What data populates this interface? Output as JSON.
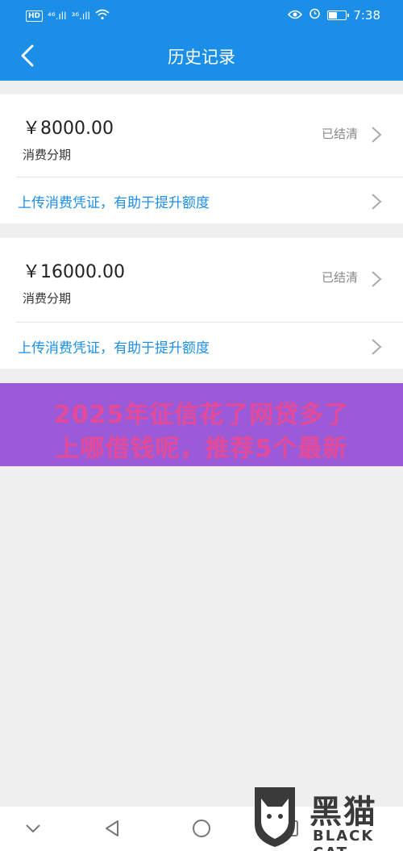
{
  "status_bar": {
    "left_badge": "HD",
    "signal1": "⁴⁶.ıll",
    "signal2": "³⁶.ıll",
    "time": "7:38",
    "battery_level": 0.45
  },
  "header": {
    "title": "历史记录"
  },
  "records": [
    {
      "amount": "￥8000.00",
      "type": "消费分期",
      "status": "已结清",
      "link": "上传消费凭证，有助于提升额度"
    },
    {
      "amount": "￥16000.00",
      "type": "消费分期",
      "status": "已结清",
      "link": "上传消费凭证，有助于提升额度"
    }
  ],
  "banner": {
    "line1": "2025年征信花了网贷多了",
    "line2": "上哪借钱呢，推荐5个最新"
  },
  "watermark": {
    "cn": "黑猫",
    "en": "BLACK CAT"
  },
  "colors": {
    "primary": "#1b8ee8",
    "banner_bg": "#9b5bd8",
    "banner_text": "#e34a9a"
  }
}
